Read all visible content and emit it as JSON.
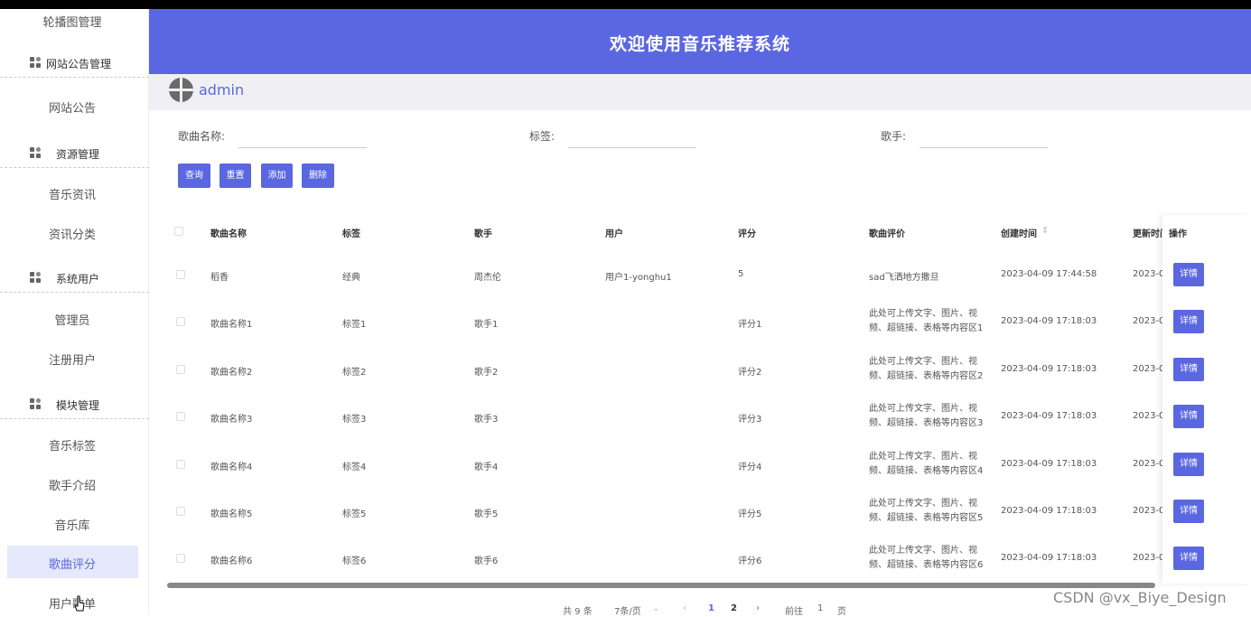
{
  "header": {
    "title": "欢迎使用音乐推荐系统"
  },
  "user": {
    "name": "admin"
  },
  "sidebar": {
    "items": [
      {
        "label": "轮播图管理",
        "type": "item"
      },
      {
        "label": "网站公告管理",
        "type": "group"
      },
      {
        "label": "网站公告",
        "type": "item"
      },
      {
        "label": "资源管理",
        "type": "group"
      },
      {
        "label": "音乐资讯",
        "type": "item"
      },
      {
        "label": "资讯分类",
        "type": "item"
      },
      {
        "label": "系统用户",
        "type": "group"
      },
      {
        "label": "管理员",
        "type": "item"
      },
      {
        "label": "注册用户",
        "type": "item"
      },
      {
        "label": "模块管理",
        "type": "group"
      },
      {
        "label": "音乐标签",
        "type": "item"
      },
      {
        "label": "歌手介绍",
        "type": "item"
      },
      {
        "label": "音乐库",
        "type": "item"
      },
      {
        "label": "歌曲评分",
        "type": "item",
        "active": true
      },
      {
        "label": "用户歌单",
        "type": "item"
      }
    ]
  },
  "search": {
    "song_label": "歌曲名称:",
    "tag_label": "标签:",
    "singer_label": "歌手:",
    "song_value": "",
    "tag_value": "",
    "singer_value": ""
  },
  "buttons": {
    "query": "查询",
    "reset": "重置",
    "add": "添加",
    "delete": "删除"
  },
  "table": {
    "headers": {
      "name": "歌曲名称",
      "tag": "标签",
      "singer": "歌手",
      "user": "用户",
      "score": "评分",
      "review": "歌曲评价",
      "created": "创建时间",
      "updated": "更新时间",
      "ops": "操作"
    },
    "sort_icon": "sort-icon",
    "detail_label": "详情",
    "rows": [
      {
        "name": "稻香",
        "tag": "经典",
        "singer": "周杰伦",
        "user": "用户1-yonghu1",
        "score": "5",
        "review1": "sad飞洒地方撒旦",
        "review2": "",
        "created": "2023-04-09 17:44:58",
        "updated": "2023-0"
      },
      {
        "name": "歌曲名称1",
        "tag": "标签1",
        "singer": "歌手1",
        "user": "",
        "score": "评分1",
        "review1": "此处可上传文字、图片、视",
        "review2": "频、超链接、表格等内容区1",
        "created": "2023-04-09 17:18:03",
        "updated": "2023-0"
      },
      {
        "name": "歌曲名称2",
        "tag": "标签2",
        "singer": "歌手2",
        "user": "",
        "score": "评分2",
        "review1": "此处可上传文字、图片、视",
        "review2": "频、超链接、表格等内容区2",
        "created": "2023-04-09 17:18:03",
        "updated": "2023-0"
      },
      {
        "name": "歌曲名称3",
        "tag": "标签3",
        "singer": "歌手3",
        "user": "",
        "score": "评分3",
        "review1": "此处可上传文字、图片、视",
        "review2": "频、超链接、表格等内容区3",
        "created": "2023-04-09 17:18:03",
        "updated": "2023-0"
      },
      {
        "name": "歌曲名称4",
        "tag": "标签4",
        "singer": "歌手4",
        "user": "",
        "score": "评分4",
        "review1": "此处可上传文字、图片、视",
        "review2": "频、超链接、表格等内容区4",
        "created": "2023-04-09 17:18:03",
        "updated": "2023-0"
      },
      {
        "name": "歌曲名称5",
        "tag": "标签5",
        "singer": "歌手5",
        "user": "",
        "score": "评分5",
        "review1": "此处可上传文字、图片、视",
        "review2": "频、超链接、表格等内容区5",
        "created": "2023-04-09 17:18:03",
        "updated": "2023-0"
      },
      {
        "name": "歌曲名称6",
        "tag": "标签6",
        "singer": "歌手6",
        "user": "",
        "score": "评分6",
        "review1": "此处可上传文字、图片、视",
        "review2": "频、超链接、表格等内容区6",
        "created": "2023-04-09 17:18:03",
        "updated": "2023-0"
      }
    ]
  },
  "pagination": {
    "total": "共 9 条",
    "page_size": "7条/页",
    "prev": "‹",
    "pages": [
      "1",
      "2"
    ],
    "next": "›",
    "goto_label": "前往",
    "goto_value": "1",
    "page_suffix": "页"
  },
  "watermark": "CSDN @vx_Biye_Design",
  "colors": {
    "primary": "#5b67e0",
    "active_bg": "#e6e8fb"
  }
}
